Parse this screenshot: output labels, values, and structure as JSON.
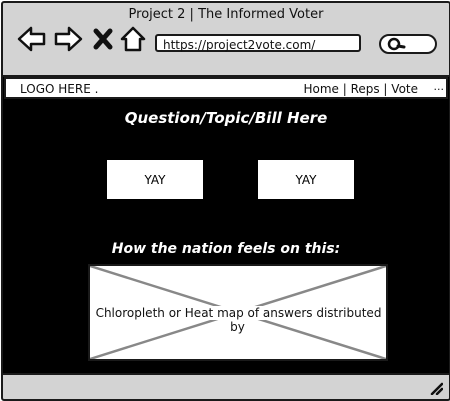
{
  "window": {
    "title": "Project 2 | The Informed Voter"
  },
  "browser": {
    "url": "https://project2vote.com/",
    "icons": [
      "back-arrow-icon",
      "forward-arrow-icon",
      "close-icon",
      "home-icon",
      "search-icon"
    ]
  },
  "navbar": {
    "logo": "LOGO HERE .",
    "links": "Home | Reps | Vote",
    "more": "..."
  },
  "main": {
    "question": "Question/Topic/Bill Here",
    "button_left": "YAY",
    "button_right": "YAY",
    "nation_heading": "How the nation feels on this:",
    "map_placeholder": "Chloropleth or Heat map of answers distributed by"
  },
  "colors": {
    "background": "#000000",
    "chrome": "#d3d3d3",
    "text_inverse": "#ffffff"
  }
}
